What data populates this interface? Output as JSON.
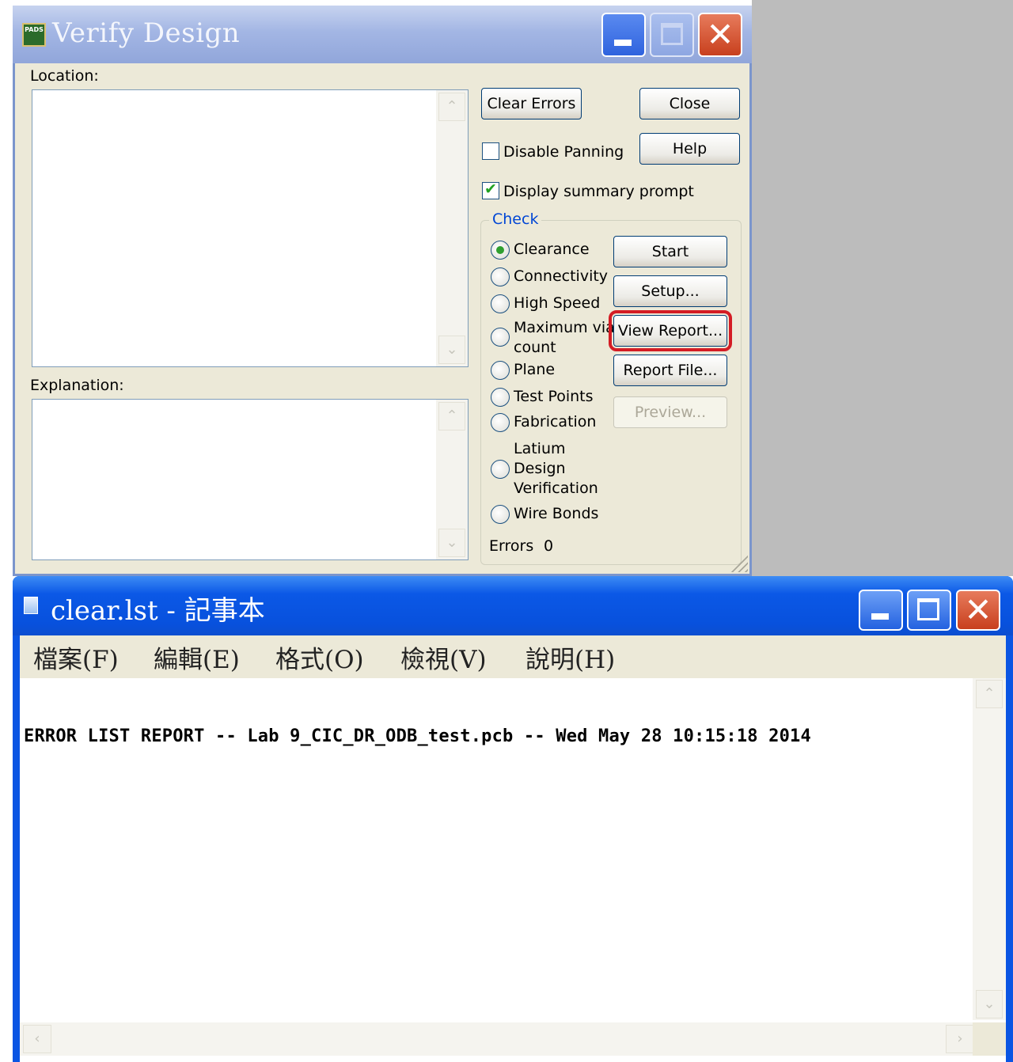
{
  "verify_design": {
    "title": "Verify Design",
    "app_icon_text": "PADS",
    "location_label": "Location:",
    "explanation_label": "Explanation:",
    "buttons": {
      "clear_errors": "Clear Errors",
      "close": "Close",
      "help": "Help",
      "start": "Start",
      "setup": "Setup...",
      "view_report": "View Report...",
      "report_file": "Report File...",
      "preview": "Preview..."
    },
    "disable_panning": {
      "label": "Disable Panning",
      "checked": false
    },
    "display_summary_prompt": {
      "label": "Display summary prompt",
      "checked": true
    },
    "check_group": {
      "title": "Check",
      "options": [
        {
          "label": "Clearance",
          "selected": true
        },
        {
          "label": "Connectivity",
          "selected": false
        },
        {
          "label": "High Speed",
          "selected": false
        },
        {
          "label": "Maximum via count",
          "line1": "Maximum via",
          "line2": "count",
          "selected": false
        },
        {
          "label": "Plane",
          "selected": false
        },
        {
          "label": "Test Points",
          "selected": false
        },
        {
          "label": "Fabrication",
          "selected": false
        },
        {
          "label": "Latium Design Verification",
          "line1": "Latium",
          "line2": "Design",
          "line3": "Verification",
          "selected": false
        },
        {
          "label": "Wire Bonds",
          "selected": false
        }
      ]
    },
    "errors": {
      "label": "Errors",
      "value": "0"
    }
  },
  "notepad": {
    "title": "clear.lst - 記事本",
    "menu": [
      "檔案(F)",
      "編輯(E)",
      "格式(O)",
      "檢視(V)",
      "說明(H)"
    ],
    "content": "ERROR LIST REPORT -- Lab 9_CIC_DR_ODB_test.pcb -- Wed May 28 10:15:18 2014"
  },
  "colors": {
    "xp_blue": "#0a55e3",
    "dialog_face": "#ece9d8",
    "highlight_red": "#d41c24",
    "check_green": "#2f9f2f"
  }
}
